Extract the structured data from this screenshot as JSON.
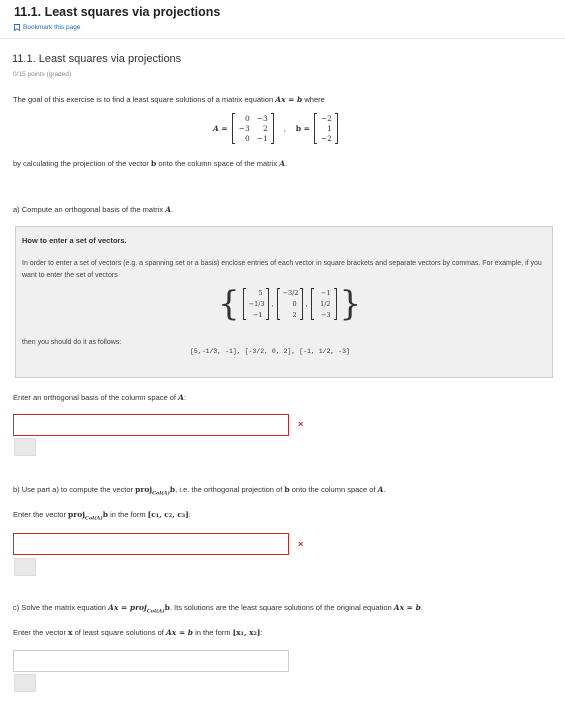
{
  "header": {
    "title": "11.1. Least squares via projections",
    "bookmark_label": "Bookmark this page"
  },
  "exercise": {
    "title": "11.1. Least squares via projections",
    "points": "0/15 points (graded)",
    "intro_prefix": "The goal of this exercise is to find a least square solutions of a matrix equation",
    "intro_eq": "Ax = b",
    "intro_suffix": "where",
    "matrix_A_label": "A =",
    "matrix_A": [
      [
        "0",
        "−3"
      ],
      [
        "−3",
        "2"
      ],
      [
        "0",
        "−1"
      ]
    ],
    "vector_b_label": "b =",
    "vector_b": [
      "−2",
      "1",
      "−2"
    ],
    "conclusion_prefix": "by calculating the projection of the vector",
    "conclusion_b": "b",
    "conclusion_mid": "onto the column space of the matrix",
    "conclusion_A": "A",
    "conclusion_end": "."
  },
  "part_a": {
    "prompt_prefix": "a) Compute an orthogonal basis of the matrix",
    "prompt_A": "A",
    "prompt_end": ".",
    "howto_title": "How to enter a set of vectors.",
    "howto_text": "In order to enter a set of vectors (e.g. a spanning set or a basis) enclose entries of each vector in square brackets and separate vectors by commas. For example, if you want to enter the set of vectors",
    "example_vectors": [
      [
        "5",
        "−1/3",
        "−1"
      ],
      [
        "−3/2",
        "0",
        "2"
      ],
      [
        "−1",
        "1/2",
        "−3"
      ]
    ],
    "then_text": "then you should do it as follows:",
    "code_sample": "[5,-1/3, -1], [-3/2, 0, 2], [-1, 1/2, -3]",
    "input_label_prefix": "Enter an orthogonal basis of the column space of",
    "input_label_A": "A",
    "input_label_end": ":",
    "input_value": "",
    "status": "×"
  },
  "part_b": {
    "prompt_prefix": "b) Use part a) to compute the vector",
    "proj": "proj",
    "proj_sub": "Col(A)",
    "prompt_b": "b",
    "prompt_suffix": ", i.e. the orthogonal projection of",
    "prompt_b2": "b",
    "prompt_suffix2": "onto the column space of",
    "prompt_A": "A",
    "prompt_end": ".",
    "input_label_prefix": "Enter the vector",
    "input_label_proj": "proj",
    "input_label_sub": "Col(A)",
    "input_label_b": "b",
    "input_label_mid": "in the form",
    "input_label_form": "[c₁, c₂, c₃]",
    "input_label_end": ":",
    "input_value": "",
    "status": "×"
  },
  "part_c": {
    "prompt_prefix": "c) Solve the matrix equation",
    "prompt_eq": "Ax = proj",
    "prompt_sub": "Col(A)",
    "prompt_b": "b",
    "prompt_suffix": ". Its solutions are the least square solutions of the original equation",
    "prompt_eq2": "Ax = b",
    "prompt_end": ".",
    "input_label_prefix": "Enter the vector",
    "input_label_x": "x",
    "input_label_mid": "of least square solutions of",
    "input_label_eq": "Ax = b",
    "input_label_mid2": "in the form",
    "input_label_form": "[x₁, x₂]",
    "input_label_end": ":",
    "input_value": ""
  },
  "colors": {
    "error": "#c62828",
    "link": "#2a6ab8",
    "box_bg": "#f0f0f0"
  }
}
